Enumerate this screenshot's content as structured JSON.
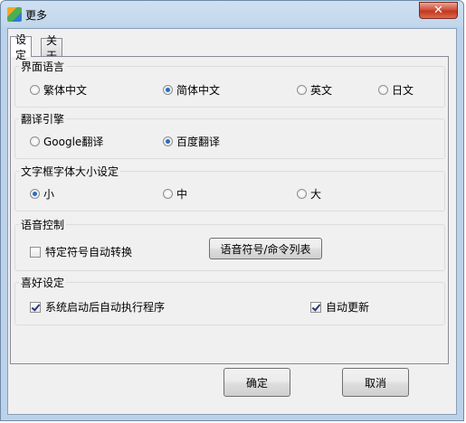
{
  "window": {
    "title": "更多",
    "close_symbol": "✕"
  },
  "tabs": [
    {
      "label": "设定",
      "active": true
    },
    {
      "label": "关于",
      "active": false
    }
  ],
  "groups": {
    "ui_language": {
      "label": "界面语言",
      "options": [
        {
          "label": "繁体中文",
          "checked": false
        },
        {
          "label": "简体中文",
          "checked": true
        },
        {
          "label": "英文",
          "checked": false
        },
        {
          "label": "日文",
          "checked": false
        }
      ]
    },
    "engine": {
      "label": "翻译引擎",
      "options": [
        {
          "label": "Google翻译",
          "checked": false
        },
        {
          "label": "百度翻译",
          "checked": true
        }
      ]
    },
    "font_size": {
      "label": "文字框字体大小设定",
      "options": [
        {
          "label": "小",
          "checked": true
        },
        {
          "label": "中",
          "checked": false
        },
        {
          "label": "大",
          "checked": false
        }
      ]
    },
    "voice": {
      "label": "语音控制",
      "checkbox": {
        "label": "特定符号自动转换",
        "checked": false
      },
      "button": "语音符号/命令列表"
    },
    "prefs": {
      "label": "喜好设定",
      "checkboxes": [
        {
          "label": "系统启动后自动执行程序",
          "checked": true
        },
        {
          "label": "自动更新",
          "checked": true
        }
      ]
    }
  },
  "buttons": {
    "ok": "确定",
    "cancel": "取消"
  }
}
